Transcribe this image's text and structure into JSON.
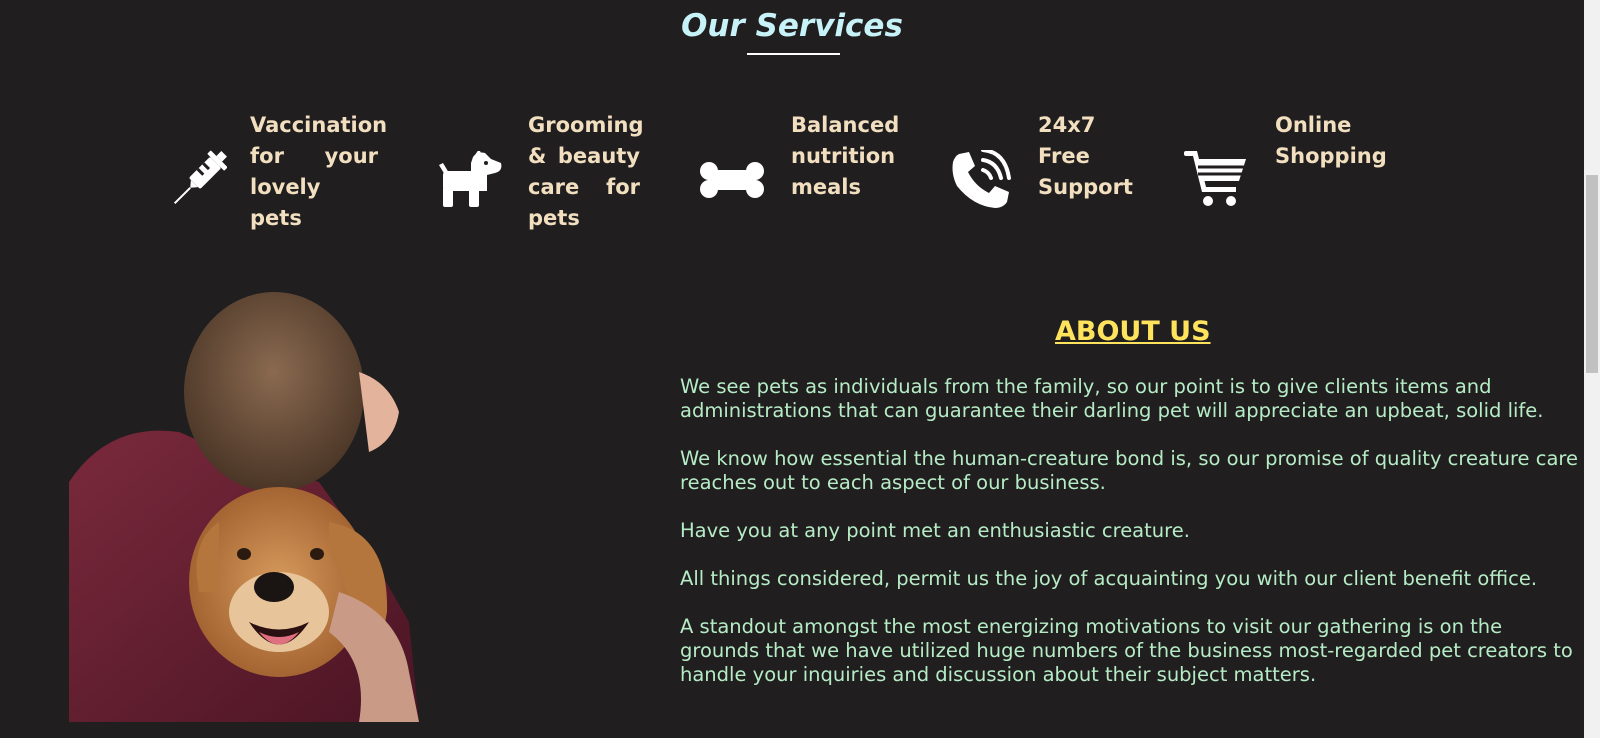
{
  "services": {
    "title": "Our Services",
    "items": [
      {
        "label": "Vaccination for your lovely pets",
        "icon": "syringe-icon"
      },
      {
        "label": "Grooming & beauty care for pets",
        "icon": "dog-icon"
      },
      {
        "label": "Balanced nutrition meals",
        "icon": "bone-icon"
      },
      {
        "label": "24x7 Free Support",
        "icon": "phone-volume-icon"
      },
      {
        "label": "Online Shopping",
        "icon": "shopping-cart-icon"
      }
    ]
  },
  "about": {
    "title": "ABOUT US",
    "paragraphs": [
      "We see pets as individuals from the family, so our point is to give clients items and administrations that can guarantee their darling pet will appreciate an upbeat, solid life.",
      "We know how essential the human-creature bond is, so our promise of quality creature care reaches out to each aspect of our business.",
      "Have you at any point met an enthusiastic creature.",
      "All things considered, permit us the joy of acquainting you with our client benefit office.",
      "A standout amongst the most energizing motivations to visit our gathering is on the grounds that we have utilized huge numbers of the business most-regarded pet creators to handle your inquiries and discussion about their subject matters."
    ]
  },
  "colors": {
    "background": "#201e1f",
    "services_title": "#c7f3f8",
    "service_label": "#f2dfc0",
    "about_title": "#ffe35d",
    "about_text": "#b6ecc5"
  }
}
